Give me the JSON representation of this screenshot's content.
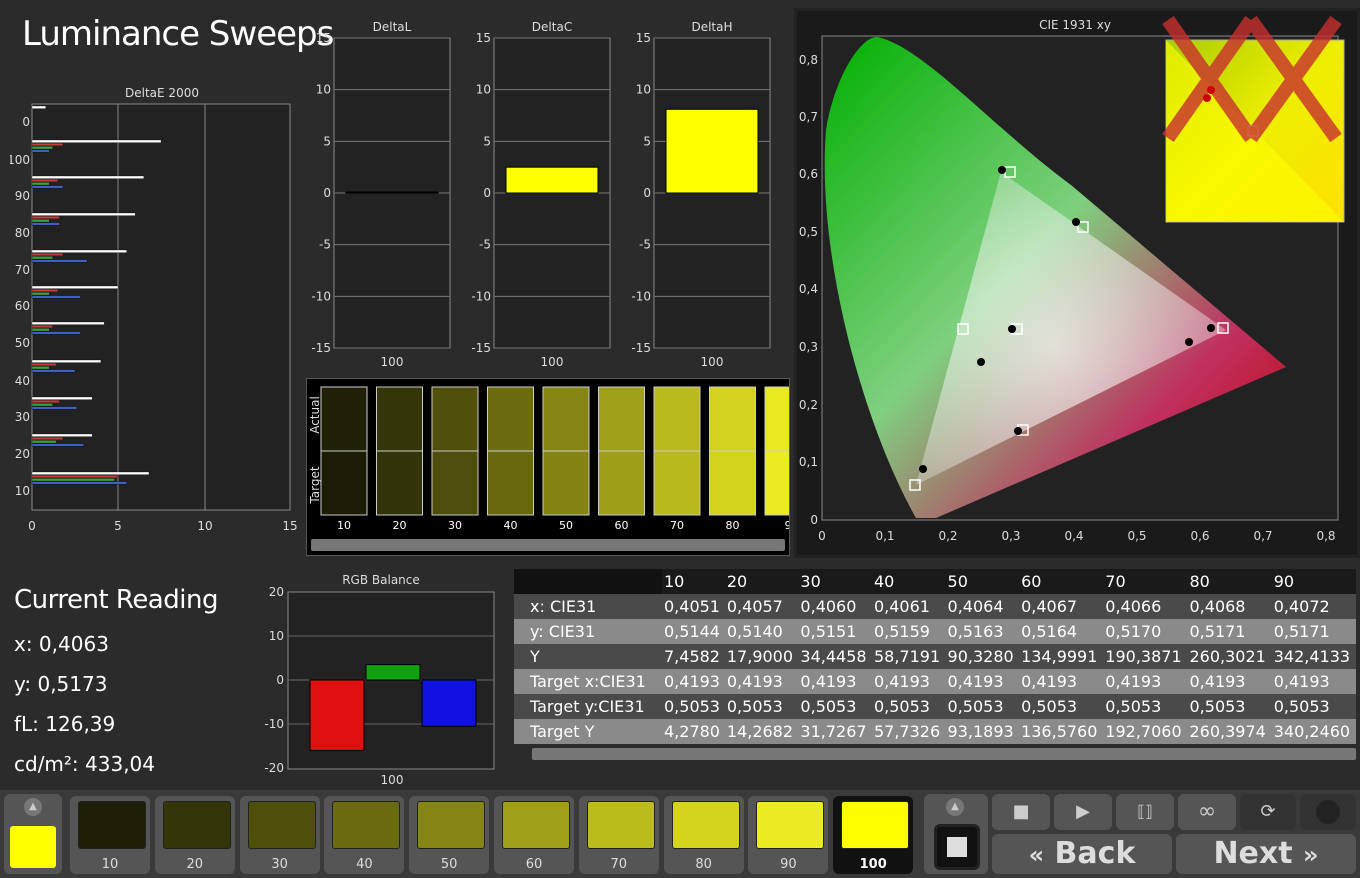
{
  "title": "Luminance Sweeps",
  "deltae": {
    "title": "DeltaE 2000",
    "xticks": [
      "0",
      "5",
      "10",
      "15"
    ],
    "yticks": [
      "0",
      "100",
      "90",
      "80",
      "70",
      "60",
      "50",
      "40",
      "30",
      "20",
      "10"
    ]
  },
  "deltas": [
    {
      "title": "DeltaL",
      "value": 0.0,
      "xlabel": "100",
      "color": "#333333"
    },
    {
      "title": "DeltaC",
      "value": 2.5,
      "xlabel": "100",
      "color": "#ffff00"
    },
    {
      "title": "DeltaH",
      "value": 8.1,
      "xlabel": "100",
      "color": "#ffff00"
    }
  ],
  "delta_yticks": [
    "15",
    "10",
    "5",
    "0",
    "-5",
    "-10",
    "-15"
  ],
  "swatch_strip": {
    "row_actual": "Actual",
    "row_target": "Target",
    "labels": [
      "10",
      "20",
      "30",
      "40",
      "50",
      "60",
      "70",
      "80",
      "9"
    ],
    "actual": [
      "#202008",
      "#35350a",
      "#50500c",
      "#6b6b10",
      "#868614",
      "#a0a018",
      "#baba1c",
      "#d2d21f",
      "#e9e920"
    ],
    "target": [
      "#1c1c06",
      "#333309",
      "#4d4d0c",
      "#68680f",
      "#848413",
      "#9e9e17",
      "#b9b91b",
      "#d3d31e",
      "#ebeb21"
    ]
  },
  "cie": {
    "title": "CIE 1931 xy",
    "xticks": [
      "0",
      "0,1",
      "0,2",
      "0,3",
      "0,4",
      "0,5",
      "0,6",
      "0,7",
      "0,8"
    ],
    "yticks": [
      "0,8",
      "0,7",
      "0,6",
      "0,5",
      "0,4",
      "0,3",
      "0,2",
      "0,1",
      "0"
    ]
  },
  "current_reading": {
    "title": "Current Reading",
    "x": "x: 0,4063",
    "y": "y: 0,5173",
    "fl": "fL: 126,39",
    "cdm": "cd/m²: 433,04"
  },
  "rgb_balance": {
    "title": "RGB Balance",
    "yticks": [
      "20",
      "10",
      "0",
      "-10",
      "-20"
    ],
    "xlabel": "100",
    "values": {
      "r": -16,
      "g": 3.5,
      "b": -10.5
    }
  },
  "table": {
    "headers": [
      "",
      "10",
      "20",
      "30",
      "40",
      "50",
      "60",
      "70",
      "80",
      "90"
    ],
    "rows": [
      [
        "x: CIE31",
        "0,4051",
        "0,4057",
        "0,4060",
        "0,4061",
        "0,4064",
        "0,4067",
        "0,4066",
        "0,4068",
        "0,4072"
      ],
      [
        "y: CIE31",
        "0,5144",
        "0,5140",
        "0,5151",
        "0,5159",
        "0,5163",
        "0,5164",
        "0,5170",
        "0,5171",
        "0,5171"
      ],
      [
        "Y",
        "7,4582",
        "17,9000",
        "34,4458",
        "58,7191",
        "90,3280",
        "134,9991",
        "190,3871",
        "260,3021",
        "342,4133"
      ],
      [
        "Target x:CIE31",
        "0,4193",
        "0,4193",
        "0,4193",
        "0,4193",
        "0,4193",
        "0,4193",
        "0,4193",
        "0,4193",
        "0,4193"
      ],
      [
        "Target y:CIE31",
        "0,5053",
        "0,5053",
        "0,5053",
        "0,5053",
        "0,5053",
        "0,5053",
        "0,5053",
        "0,5053",
        "0,5053"
      ],
      [
        "Target Y",
        "4,2780",
        "14,2682",
        "31,7267",
        "57,7326",
        "93,1893",
        "136,5760",
        "192,7060",
        "260,3974",
        "340,2460"
      ]
    ]
  },
  "bottom": {
    "swatches": [
      {
        "label": "10",
        "color": "#1f1f08"
      },
      {
        "label": "20",
        "color": "#35350a"
      },
      {
        "label": "30",
        "color": "#4f4f0c"
      },
      {
        "label": "40",
        "color": "#6a6a10"
      },
      {
        "label": "50",
        "color": "#858514"
      },
      {
        "label": "60",
        "color": "#a0a018"
      },
      {
        "label": "70",
        "color": "#bbbb1c"
      },
      {
        "label": "80",
        "color": "#d4d41f"
      },
      {
        "label": "90",
        "color": "#ebeb21"
      },
      {
        "label": "100",
        "color": "#ffff00"
      }
    ],
    "back_label": "Back",
    "next_label": "Next"
  },
  "accent_color": "#ffff00"
}
